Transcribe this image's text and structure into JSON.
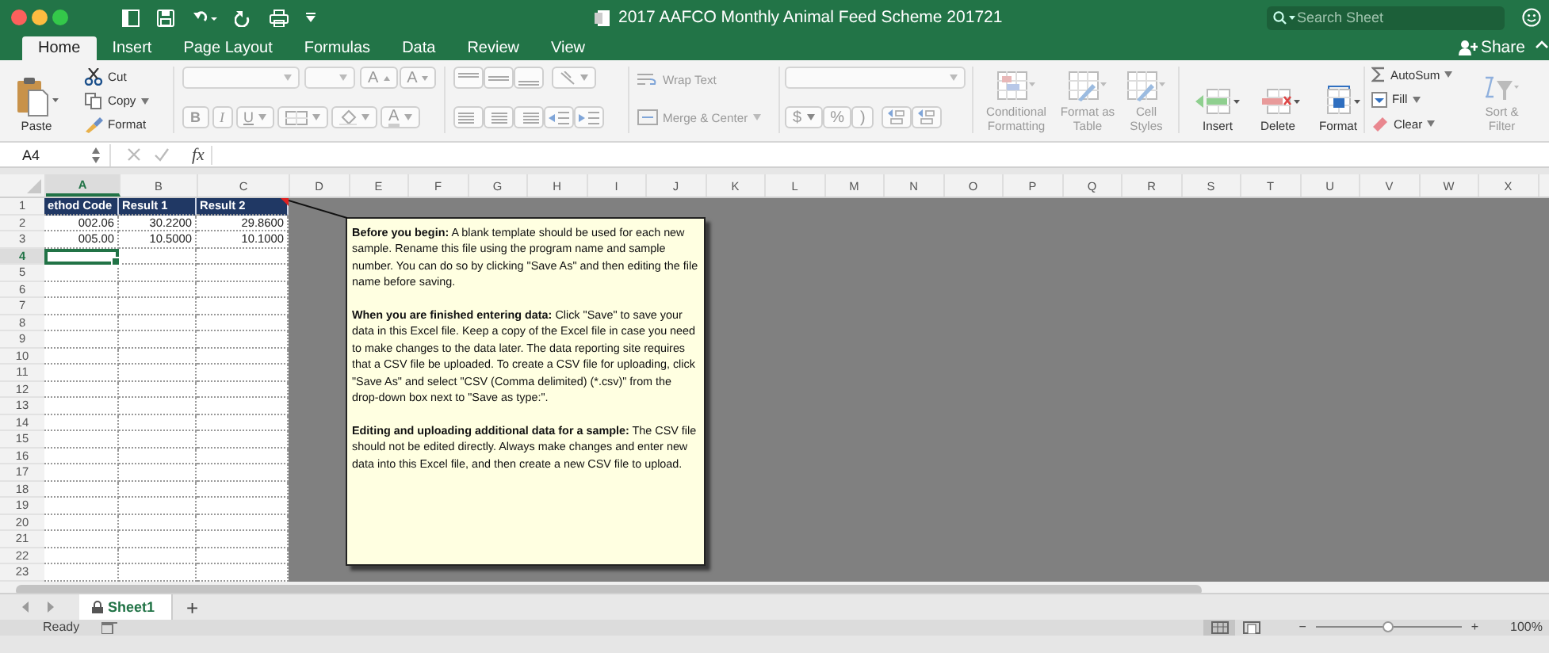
{
  "window": {
    "title": "2017 AAFCO Monthly Animal Feed Scheme 201721"
  },
  "search": {
    "placeholder": "Search Sheet"
  },
  "share": "Share",
  "tabs": [
    {
      "label": "Home",
      "selected": true
    },
    {
      "label": "Insert",
      "selected": false
    },
    {
      "label": "Page Layout",
      "selected": false
    },
    {
      "label": "Formulas",
      "selected": false
    },
    {
      "label": "Data",
      "selected": false
    },
    {
      "label": "Review",
      "selected": false
    },
    {
      "label": "View",
      "selected": false
    }
  ],
  "ribbon": {
    "clipboard": [
      {
        "kind": "paste",
        "label": "Paste",
        "disabled": false
      },
      {
        "kind": "cut",
        "label": "Cut",
        "disabled": false
      },
      {
        "kind": "copy",
        "label": "Copy",
        "disabled": false
      },
      {
        "kind": "format_painter",
        "label": "Format",
        "disabled": false
      }
    ],
    "font": [
      {
        "kind": "grow",
        "label": "A",
        "disabled": true
      },
      {
        "kind": "shrink",
        "label": "A",
        "disabled": true
      },
      {
        "kind": "bold",
        "label": "B",
        "disabled": true
      },
      {
        "kind": "italic",
        "label": "I",
        "disabled": true
      },
      {
        "kind": "underline",
        "label": "U",
        "disabled": true
      },
      {
        "kind": "font_color",
        "label": "A",
        "disabled": true
      }
    ],
    "alignment": [
      {
        "kind": "wrap_text",
        "label": "Wrap Text",
        "disabled": true
      },
      {
        "kind": "merge_center",
        "label": "Merge & Center",
        "disabled": true
      }
    ],
    "number": [
      {
        "kind": "currency",
        "label": "$",
        "disabled": true
      },
      {
        "kind": "percent",
        "label": "%",
        "disabled": true
      },
      {
        "kind": "comma",
        "label": ")",
        "disabled": true
      }
    ],
    "styles": [
      {
        "kind": "conditional",
        "label": "Conditional Formatting",
        "disabled": true
      },
      {
        "kind": "table",
        "label": "Format as Table",
        "disabled": true
      },
      {
        "kind": "cell_styles",
        "label": "Cell Styles",
        "disabled": true
      }
    ],
    "cells": [
      {
        "kind": "insert",
        "label": "Insert",
        "disabled": false
      },
      {
        "kind": "delete",
        "label": "Delete",
        "disabled": false
      },
      {
        "kind": "format",
        "label": "Format",
        "disabled": false
      }
    ],
    "editing": [
      {
        "kind": "autosum",
        "label": "AutoSum",
        "disabled": false
      },
      {
        "kind": "fill",
        "label": "Fill",
        "disabled": false
      },
      {
        "kind": "clear",
        "label": "Clear",
        "disabled": false
      },
      {
        "kind": "sort",
        "label": "Sort & Filter",
        "disabled": true
      }
    ]
  },
  "formula_bar": {
    "name_box": "A4",
    "function_button": "fx"
  },
  "sheet": {
    "columns": [
      {
        "label": "A",
        "selected": true
      },
      {
        "label": "B",
        "selected": false
      },
      {
        "label": "C",
        "selected": false
      },
      {
        "label": "D",
        "selected": false
      },
      {
        "label": "E",
        "selected": false
      },
      {
        "label": "F",
        "selected": false
      },
      {
        "label": "G",
        "selected": false
      },
      {
        "label": "H",
        "selected": false
      },
      {
        "label": "I",
        "selected": false
      },
      {
        "label": "J",
        "selected": false
      },
      {
        "label": "K",
        "selected": false
      },
      {
        "label": "L",
        "selected": false
      },
      {
        "label": "M",
        "selected": false
      },
      {
        "label": "N",
        "selected": false
      },
      {
        "label": "O",
        "selected": false
      },
      {
        "label": "P",
        "selected": false
      },
      {
        "label": "Q",
        "selected": false
      },
      {
        "label": "R",
        "selected": false
      },
      {
        "label": "S",
        "selected": false
      },
      {
        "label": "T",
        "selected": false
      },
      {
        "label": "U",
        "selected": false
      },
      {
        "label": "V",
        "selected": false
      },
      {
        "label": "W",
        "selected": false
      },
      {
        "label": "X",
        "selected": false
      }
    ],
    "rows": [
      {
        "label": "1",
        "kind": "header",
        "selected": false,
        "cells": [
          {
            "value": "ethod Code",
            "selected": false
          },
          {
            "value": "Result 1",
            "selected": false
          },
          {
            "value": "Result 2",
            "selected": false
          }
        ]
      },
      {
        "label": "2",
        "kind": "data",
        "selected": false,
        "cells": [
          {
            "value": "002.06",
            "selected": false
          },
          {
            "value": "30.2200",
            "selected": false
          },
          {
            "value": "29.8600",
            "selected": false
          }
        ]
      },
      {
        "label": "3",
        "kind": "data",
        "selected": false,
        "cells": [
          {
            "value": "005.00",
            "selected": false
          },
          {
            "value": "10.5000",
            "selected": false
          },
          {
            "value": "10.1000",
            "selected": false
          }
        ]
      },
      {
        "label": "4",
        "kind": "data",
        "selected": true,
        "cells": [
          {
            "selected": true
          },
          {
            "selected": false
          },
          {
            "selected": false
          }
        ]
      },
      {
        "label": "5",
        "kind": "data",
        "selected": false
      },
      {
        "label": "6",
        "kind": "data",
        "selected": false
      },
      {
        "label": "7",
        "kind": "data",
        "selected": false
      },
      {
        "label": "8",
        "kind": "data",
        "selected": false
      },
      {
        "label": "9",
        "kind": "data",
        "selected": false
      },
      {
        "label": "10",
        "kind": "data",
        "selected": false
      },
      {
        "label": "11",
        "kind": "data",
        "selected": false
      },
      {
        "label": "12",
        "kind": "data",
        "selected": false
      },
      {
        "label": "13",
        "kind": "data",
        "selected": false
      },
      {
        "label": "14",
        "kind": "data",
        "selected": false
      },
      {
        "label": "15",
        "kind": "data",
        "selected": false
      },
      {
        "label": "16",
        "kind": "data",
        "selected": false
      },
      {
        "label": "17",
        "kind": "data",
        "selected": false
      },
      {
        "label": "18",
        "kind": "data",
        "selected": false
      },
      {
        "label": "19",
        "kind": "data",
        "selected": false
      },
      {
        "label": "20",
        "kind": "data",
        "selected": false
      },
      {
        "label": "21",
        "kind": "data",
        "selected": false
      },
      {
        "label": "22",
        "kind": "data",
        "selected": false
      },
      {
        "label": "23",
        "kind": "data",
        "selected": false
      }
    ],
    "comment": {
      "paragraphs": [
        "**Before you begin:**  A blank template should be used for each new sample.  Rename this file using the program name and sample number.  You can do so by clicking \"Save As\" and then editing the file name before saving.",
        "**When you are finished entering data:**  Click \"Save\" to save your data in this Excel file.  Keep a copy of the Excel file in case you need to make changes to the data later.  The data reporting site requires that a CSV file be uploaded.  To create a CSV file for uploading, click \"Save As\" and select \"CSV (Comma delimited) (*.csv)\" from the drop-down box next to \"Save as type:\".",
        "**Editing and uploading additional data for a sample:**  The CSV file should not be edited directly.  Always make changes and enter new data into this Excel file, and then create a new CSV file to upload."
      ]
    }
  },
  "sheet_tabs": [
    {
      "label": "Sheet1",
      "selected": true
    }
  ],
  "add_sheet": "+",
  "status_bar": {
    "status": "Ready",
    "views": [
      {
        "kind": "normal",
        "selected": true
      },
      {
        "kind": "page_layout",
        "selected": false
      }
    ],
    "zoom_out": "−",
    "zoom": {
      "level": 0.5
    },
    "zoom_in": "+",
    "zoom_label": "100%"
  }
}
